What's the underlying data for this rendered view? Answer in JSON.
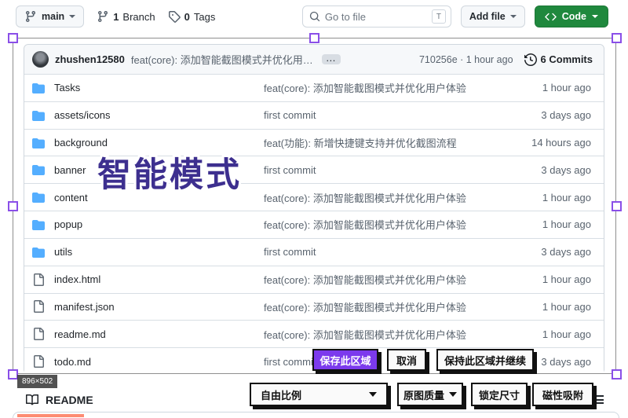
{
  "topbar": {
    "branch_button": {
      "label": "main"
    },
    "branches": {
      "count": "1",
      "label": "Branch"
    },
    "tags": {
      "count": "0",
      "label": "Tags"
    },
    "search": {
      "placeholder": "Go to file",
      "shortcut": "T"
    },
    "add_file": {
      "label": "Add file"
    },
    "code_button": {
      "label": "Code"
    }
  },
  "commit_bar": {
    "author": "zhushen12580",
    "message": "feat(core): 添加智能截图模式并优化用户体验",
    "ellipsis": "…",
    "hash_time": "710256e · 1 hour ago",
    "commits": "6 Commits"
  },
  "file_table": {
    "rows": [
      {
        "name": "Tasks",
        "type": "folder",
        "message": "feat(core): 添加智能截图模式并优化用户体验",
        "time": "1 hour ago"
      },
      {
        "name": "assets/icons",
        "type": "folder",
        "message": "first commit",
        "time": "3 days ago"
      },
      {
        "name": "background",
        "type": "folder",
        "message": "feat(功能): 新增快捷键支持并优化截图流程",
        "time": "14 hours ago"
      },
      {
        "name": "banner",
        "type": "folder",
        "message": "first commit",
        "time": "3 days ago"
      },
      {
        "name": "content",
        "type": "folder",
        "message": "feat(core): 添加智能截图模式并优化用户体验",
        "time": "1 hour ago"
      },
      {
        "name": "popup",
        "type": "folder",
        "message": "feat(core): 添加智能截图模式并优化用户体验",
        "time": "1 hour ago"
      },
      {
        "name": "utils",
        "type": "folder",
        "message": "first commit",
        "time": "3 days ago"
      },
      {
        "name": "index.html",
        "type": "file",
        "message": "feat(core): 添加智能截图模式并优化用户体验",
        "time": "1 hour ago"
      },
      {
        "name": "manifest.json",
        "type": "file",
        "message": "feat(core): 添加智能截图模式并优化用户体验",
        "time": "1 hour ago"
      },
      {
        "name": "readme.md",
        "type": "file",
        "message": "feat(core): 添加智能截图模式并优化用户体验",
        "time": "1 hour ago"
      },
      {
        "name": "todo.md",
        "type": "file",
        "message": "first commit",
        "time": "3 days ago"
      }
    ]
  },
  "watermark": "智能模式",
  "screenshot_tool": {
    "size_badge": "896×502",
    "save_button": "保存此区域",
    "cancel_button": "取消",
    "keep_button": "保持此区域并继续",
    "ratio_select": "自由比例",
    "quality_select": "原图质量",
    "lock_size_button": "锁定尺寸",
    "magnet_button": "磁性吸附"
  },
  "readme": {
    "title": "README"
  },
  "colors": {
    "accent_purple": "#7c3aed",
    "handle_purple": "#8a4fe8",
    "watermark_purple": "#3d2f8f",
    "github_green": "#1f883d",
    "folder_blue": "#54aeff",
    "readme_accent_orange": "#fd8c73"
  }
}
